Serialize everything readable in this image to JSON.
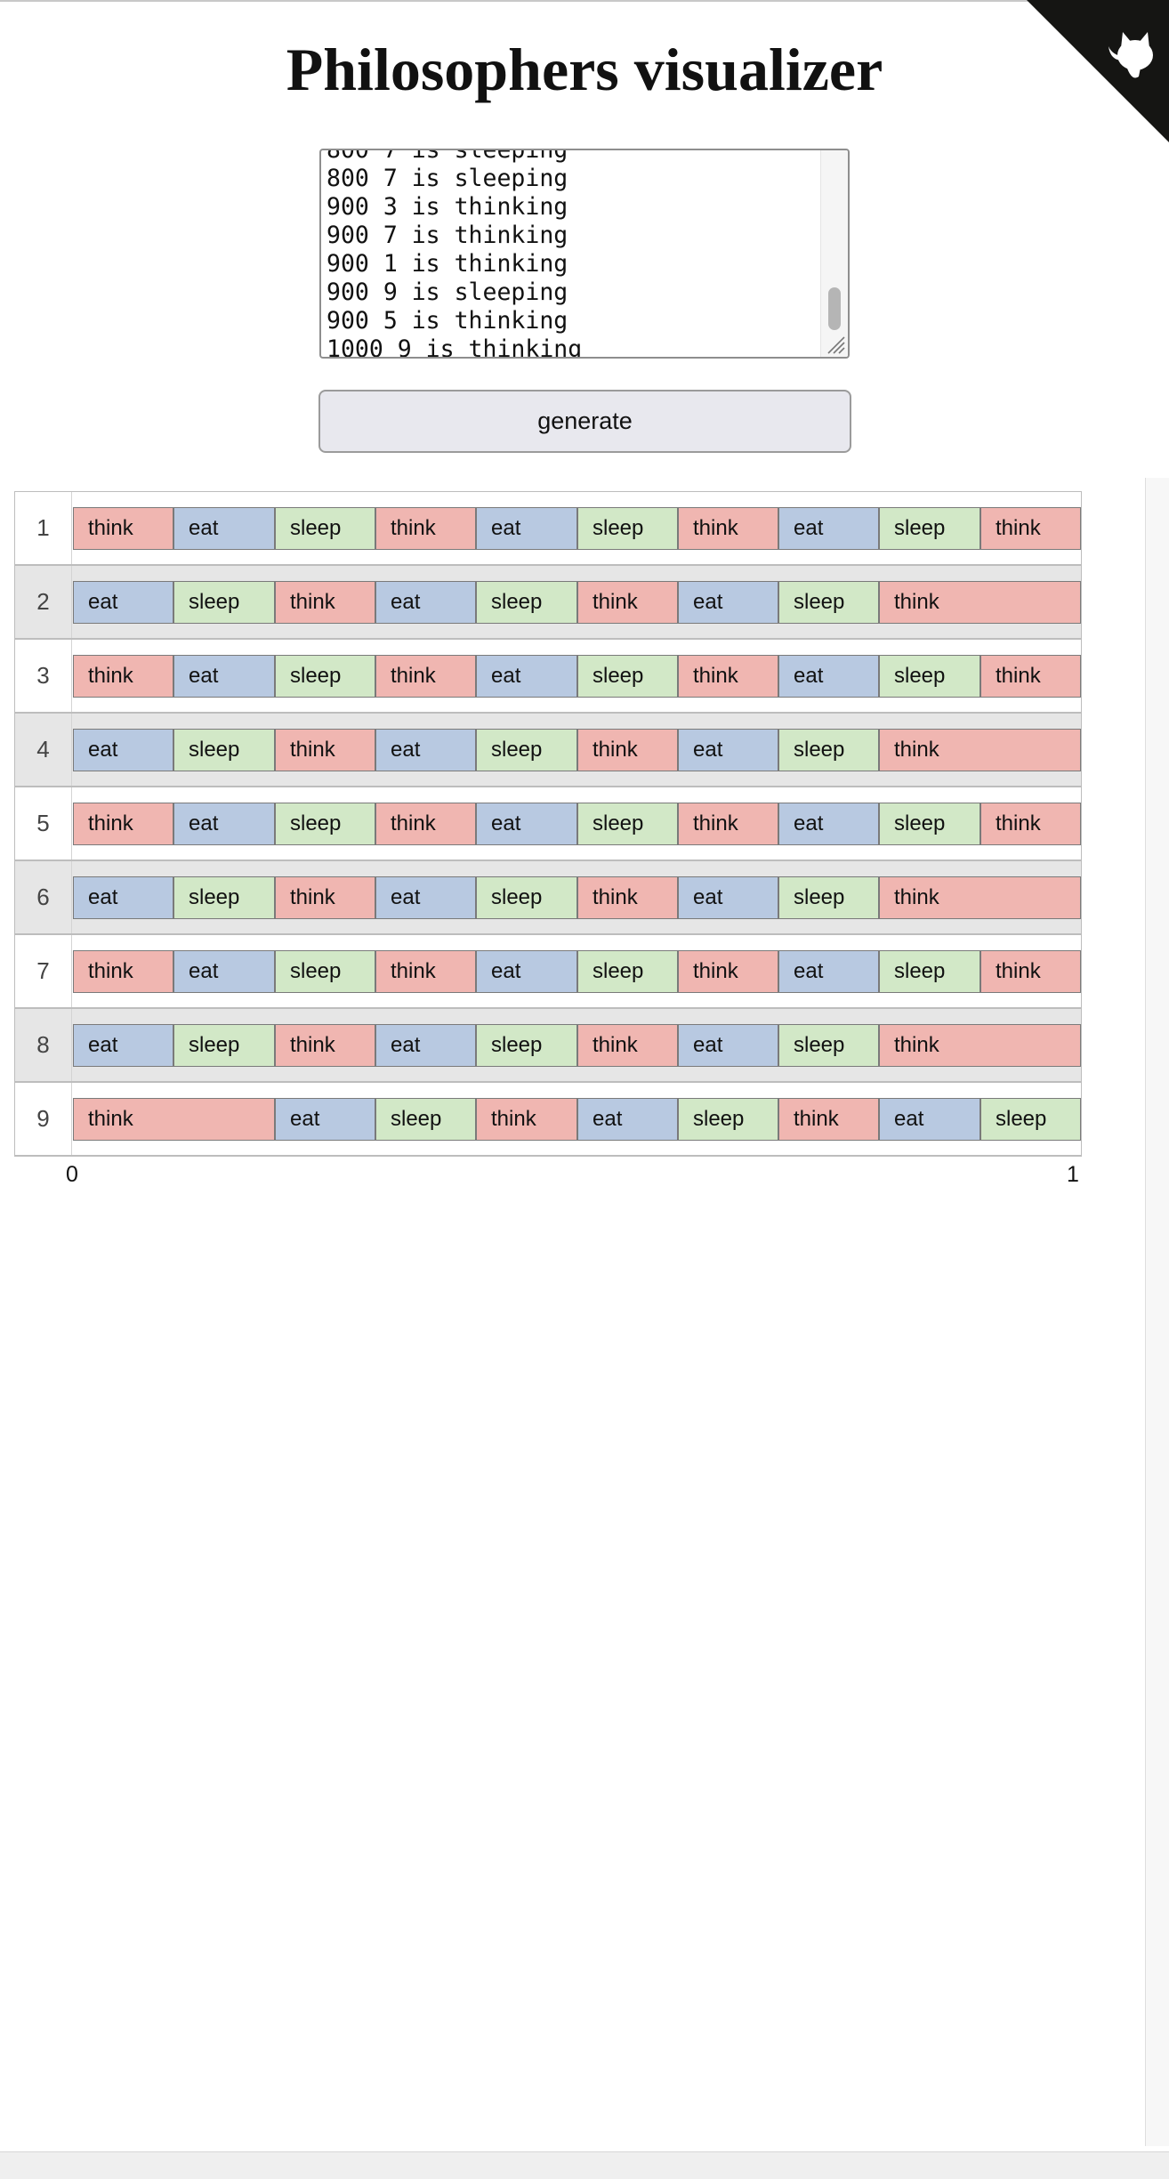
{
  "page": {
    "title": "Philosophers visualizer"
  },
  "log": {
    "lines": [
      "800 7 is sleeping",
      "800 7 is sleeping",
      "900 3 is thinking",
      "900 7 is thinking",
      "900 1 is thinking",
      "900 9 is sleeping",
      "900 5 is thinking",
      "1000 9 is thinking"
    ]
  },
  "generate_label": "generate",
  "colors": {
    "think": "#f0b6b1",
    "eat": "#b8c9e1",
    "sleep": "#d2e8c7"
  },
  "axis": {
    "start": "0",
    "end": "1"
  },
  "philosophers": [
    {
      "id": "1",
      "segments": [
        [
          "think",
          0,
          100
        ],
        [
          "eat",
          100,
          200
        ],
        [
          "sleep",
          200,
          300
        ],
        [
          "think",
          300,
          400
        ],
        [
          "eat",
          400,
          500
        ],
        [
          "sleep",
          500,
          600
        ],
        [
          "think",
          600,
          700
        ],
        [
          "eat",
          700,
          800
        ],
        [
          "sleep",
          800,
          900
        ],
        [
          "think",
          900,
          1000
        ]
      ]
    },
    {
      "id": "2",
      "segments": [
        [
          "eat",
          0,
          100
        ],
        [
          "sleep",
          100,
          200
        ],
        [
          "think",
          200,
          300
        ],
        [
          "eat",
          300,
          400
        ],
        [
          "sleep",
          400,
          500
        ],
        [
          "think",
          500,
          600
        ],
        [
          "eat",
          600,
          700
        ],
        [
          "sleep",
          700,
          800
        ],
        [
          "think",
          800,
          1000
        ]
      ]
    },
    {
      "id": "3",
      "segments": [
        [
          "think",
          0,
          100
        ],
        [
          "eat",
          100,
          200
        ],
        [
          "sleep",
          200,
          300
        ],
        [
          "think",
          300,
          400
        ],
        [
          "eat",
          400,
          500
        ],
        [
          "sleep",
          500,
          600
        ],
        [
          "think",
          600,
          700
        ],
        [
          "eat",
          700,
          800
        ],
        [
          "sleep",
          800,
          900
        ],
        [
          "think",
          900,
          1000
        ]
      ]
    },
    {
      "id": "4",
      "segments": [
        [
          "eat",
          0,
          100
        ],
        [
          "sleep",
          100,
          200
        ],
        [
          "think",
          200,
          300
        ],
        [
          "eat",
          300,
          400
        ],
        [
          "sleep",
          400,
          500
        ],
        [
          "think",
          500,
          600
        ],
        [
          "eat",
          600,
          700
        ],
        [
          "sleep",
          700,
          800
        ],
        [
          "think",
          800,
          1000
        ]
      ]
    },
    {
      "id": "5",
      "segments": [
        [
          "think",
          0,
          100
        ],
        [
          "eat",
          100,
          200
        ],
        [
          "sleep",
          200,
          300
        ],
        [
          "think",
          300,
          400
        ],
        [
          "eat",
          400,
          500
        ],
        [
          "sleep",
          500,
          600
        ],
        [
          "think",
          600,
          700
        ],
        [
          "eat",
          700,
          800
        ],
        [
          "sleep",
          800,
          900
        ],
        [
          "think",
          900,
          1000
        ]
      ]
    },
    {
      "id": "6",
      "segments": [
        [
          "eat",
          0,
          100
        ],
        [
          "sleep",
          100,
          200
        ],
        [
          "think",
          200,
          300
        ],
        [
          "eat",
          300,
          400
        ],
        [
          "sleep",
          400,
          500
        ],
        [
          "think",
          500,
          600
        ],
        [
          "eat",
          600,
          700
        ],
        [
          "sleep",
          700,
          800
        ],
        [
          "think",
          800,
          1000
        ]
      ]
    },
    {
      "id": "7",
      "segments": [
        [
          "think",
          0,
          100
        ],
        [
          "eat",
          100,
          200
        ],
        [
          "sleep",
          200,
          300
        ],
        [
          "think",
          300,
          400
        ],
        [
          "eat",
          400,
          500
        ],
        [
          "sleep",
          500,
          600
        ],
        [
          "think",
          600,
          700
        ],
        [
          "eat",
          700,
          800
        ],
        [
          "sleep",
          800,
          900
        ],
        [
          "think",
          900,
          1000
        ]
      ]
    },
    {
      "id": "8",
      "segments": [
        [
          "eat",
          0,
          100
        ],
        [
          "sleep",
          100,
          200
        ],
        [
          "think",
          200,
          300
        ],
        [
          "eat",
          300,
          400
        ],
        [
          "sleep",
          400,
          500
        ],
        [
          "think",
          500,
          600
        ],
        [
          "eat",
          600,
          700
        ],
        [
          "sleep",
          700,
          800
        ],
        [
          "think",
          800,
          1000
        ]
      ]
    },
    {
      "id": "9",
      "segments": [
        [
          "think",
          0,
          200
        ],
        [
          "eat",
          200,
          300
        ],
        [
          "sleep",
          300,
          400
        ],
        [
          "think",
          400,
          500
        ],
        [
          "eat",
          500,
          600
        ],
        [
          "sleep",
          600,
          700
        ],
        [
          "think",
          700,
          800
        ],
        [
          "eat",
          800,
          900
        ],
        [
          "sleep",
          900,
          1000
        ]
      ]
    }
  ]
}
